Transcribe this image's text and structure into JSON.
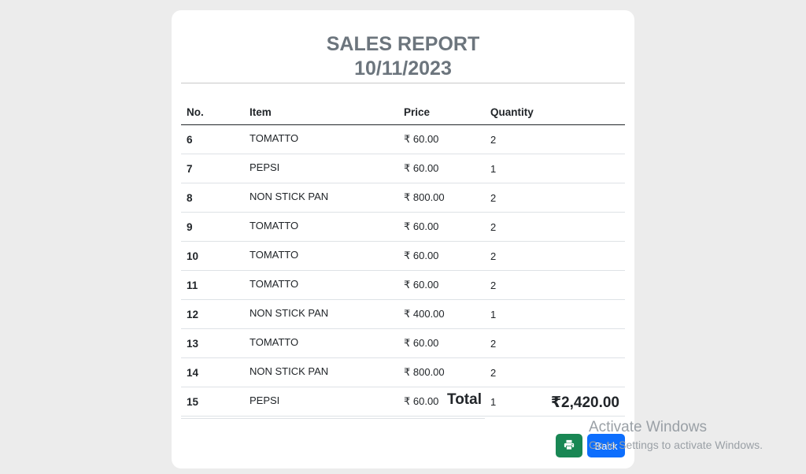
{
  "report": {
    "title": "SALES REPORT",
    "date": "10/11/2023"
  },
  "table": {
    "headers": [
      "No.",
      "Item",
      "Price",
      "Quantity"
    ],
    "rows": [
      {
        "no": "6",
        "item": "TOMATTO",
        "price": "₹ 60.00",
        "qty": "2"
      },
      {
        "no": "7",
        "item": "PEPSI",
        "price": "₹ 60.00",
        "qty": "1"
      },
      {
        "no": "8",
        "item": "NON STICK PAN",
        "price": "₹ 800.00",
        "qty": "2"
      },
      {
        "no": "9",
        "item": "TOMATTO",
        "price": "₹ 60.00",
        "qty": "2"
      },
      {
        "no": "10",
        "item": "TOMATTO",
        "price": "₹ 60.00",
        "qty": "2"
      },
      {
        "no": "11",
        "item": "TOMATTO",
        "price": "₹ 60.00",
        "qty": "2"
      },
      {
        "no": "12",
        "item": "NON STICK PAN",
        "price": "₹ 400.00",
        "qty": "1"
      },
      {
        "no": "13",
        "item": "TOMATTO",
        "price": "₹ 60.00",
        "qty": "2"
      },
      {
        "no": "14",
        "item": "NON STICK PAN",
        "price": "₹ 800.00",
        "qty": "2"
      },
      {
        "no": "15",
        "item": "PEPSI",
        "price": "₹ 60.00",
        "qty": "1"
      }
    ]
  },
  "total": {
    "label": "Total",
    "value": "₹2,420.00"
  },
  "buttons": {
    "print_icon": "printer-icon",
    "back_label": "Back"
  },
  "watermark": {
    "title": "Activate Windows",
    "subtitle": "Go to Settings to activate Windows."
  },
  "colors": {
    "print_button": "#198754",
    "back_button": "#0d6efd",
    "title_text": "#6c757d",
    "background": "#ececec"
  }
}
